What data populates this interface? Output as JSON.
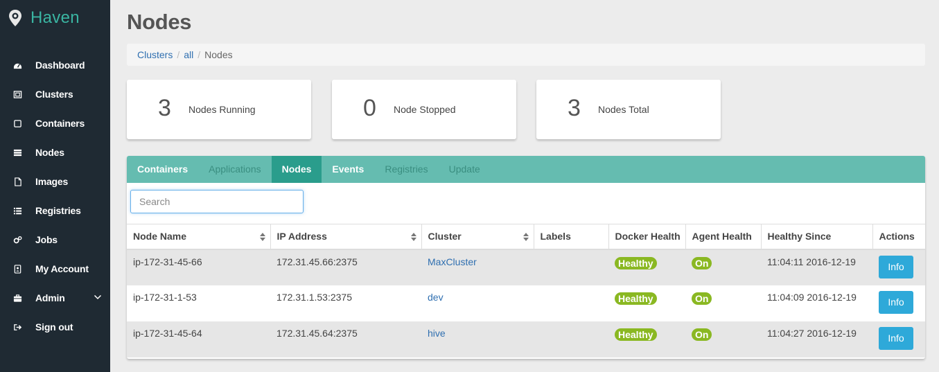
{
  "app": {
    "name": "Haven"
  },
  "sidebar": {
    "items": [
      {
        "label": "Dashboard",
        "icon": "dashboard-icon"
      },
      {
        "label": "Clusters",
        "icon": "clusters-icon"
      },
      {
        "label": "Containers",
        "icon": "containers-icon"
      },
      {
        "label": "Nodes",
        "icon": "nodes-icon"
      },
      {
        "label": "Images",
        "icon": "images-icon"
      },
      {
        "label": "Registries",
        "icon": "registries-icon"
      },
      {
        "label": "Jobs",
        "icon": "jobs-icon"
      },
      {
        "label": "My Account",
        "icon": "account-icon"
      },
      {
        "label": "Admin",
        "icon": "briefcase-icon"
      },
      {
        "label": "Sign out",
        "icon": "sign-out-icon"
      }
    ]
  },
  "page": {
    "title": "Nodes"
  },
  "breadcrumb": {
    "level1": "Clusters",
    "level2": "all",
    "current": "Nodes",
    "separator": "/"
  },
  "stats": [
    {
      "value": "3",
      "label": "Nodes Running"
    },
    {
      "value": "0",
      "label": "Node Stopped"
    },
    {
      "value": "3",
      "label": "Nodes Total"
    }
  ],
  "tabs": [
    {
      "label": "Containers",
      "state": "enabled"
    },
    {
      "label": "Applications",
      "state": "muted"
    },
    {
      "label": "Nodes",
      "state": "active"
    },
    {
      "label": "Events",
      "state": "enabled"
    },
    {
      "label": "Registries",
      "state": "muted"
    },
    {
      "label": "Update",
      "state": "muted"
    }
  ],
  "search": {
    "placeholder": "Search",
    "value": ""
  },
  "table": {
    "headers": {
      "node_name": "Node Name",
      "ip_address": "IP Address",
      "cluster": "Cluster",
      "labels": "Labels",
      "docker_health": "Docker Health",
      "agent_health": "Agent Health",
      "healthy_since": "Healthy Since",
      "actions": "Actions"
    },
    "rows": [
      {
        "node_name": "ip-172-31-45-66",
        "ip_address": "172.31.45.66:2375",
        "cluster": "MaxCluster",
        "labels": "",
        "docker_health": "Healthy",
        "agent_health": "On",
        "healthy_since": "11:04:11 2016-12-19",
        "action": "Info"
      },
      {
        "node_name": "ip-172-31-1-53",
        "ip_address": "172.31.1.53:2375",
        "cluster": "dev",
        "labels": "",
        "docker_health": "Healthy",
        "agent_health": "On",
        "healthy_since": "11:04:09 2016-12-19",
        "action": "Info"
      },
      {
        "node_name": "ip-172-31-45-64",
        "ip_address": "172.31.45.64:2375",
        "cluster": "hive",
        "labels": "",
        "docker_health": "Healthy",
        "agent_health": "On",
        "healthy_since": "11:04:27 2016-12-19",
        "action": "Info"
      }
    ]
  },
  "colors": {
    "sidebar_bg": "#1f2a33",
    "brand": "#3ab5a2",
    "tab_bar": "#65bcb0",
    "tab_active": "#2a9d8c",
    "badge_green": "#8ab822",
    "info_button": "#2ea9d9",
    "link": "#2f6fb0"
  }
}
